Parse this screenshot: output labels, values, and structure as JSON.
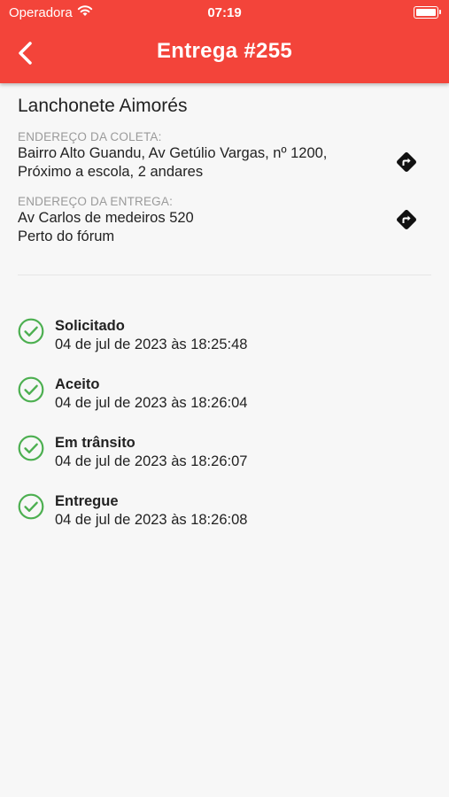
{
  "status_bar": {
    "carrier": "Operadora",
    "time": "07:19"
  },
  "header": {
    "title": "Entrega #255",
    "back_icon": "chevron-left-icon"
  },
  "store": {
    "name": "Lanchonete Aimorés"
  },
  "pickup": {
    "label": "ENDEREÇO DA COLETA:",
    "line1": "Bairro Alto Guandu, Av Getúlio Vargas, nº 1200,",
    "line2": "Próximo a escola, 2 andares",
    "icon": "directions-icon"
  },
  "delivery": {
    "label": "ENDEREÇO DA ENTREGA:",
    "line1": "Av Carlos de medeiros 520",
    "line2": "Perto do fórum",
    "icon": "directions-icon"
  },
  "timeline": [
    {
      "status": "Solicitado",
      "time": "04 de jul de 2023 às 18:25:48"
    },
    {
      "status": "Aceito",
      "time": "04 de jul de 2023 às 18:26:04"
    },
    {
      "status": "Em trânsito",
      "time": "04 de jul de 2023 às 18:26:07"
    },
    {
      "status": "Entregue",
      "time": "04 de jul de 2023 às 18:26:08"
    }
  ],
  "colors": {
    "header": "#f3443a",
    "check": "#4caf50",
    "background": "#f7f7f7"
  }
}
